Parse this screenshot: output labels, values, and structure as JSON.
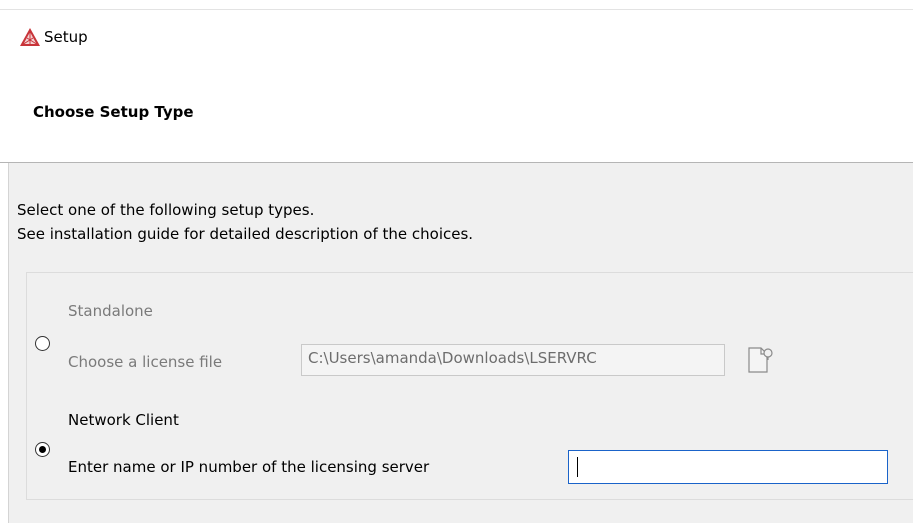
{
  "window": {
    "title": "Setup",
    "icon": "warning-triangle-icon"
  },
  "header": {
    "heading": "Choose Setup Type"
  },
  "description": {
    "line1": "Select one of the following setup types.",
    "line2": "See installation guide for detailed description of the choices."
  },
  "options": {
    "standalone": {
      "title": "Standalone",
      "selected": false,
      "enabled": false,
      "field_label": "Choose a license file",
      "field_value": "C:\\Users\\amanda\\Downloads\\LSERVRC",
      "browse_icon": "browse-file-icon"
    },
    "network": {
      "title": "Network Client",
      "selected": true,
      "enabled": true,
      "field_label": "Enter name or IP number of the licensing server",
      "field_value": ""
    }
  },
  "colors": {
    "panel_background": "#f0f0f0",
    "disabled_text": "#7a7a7a",
    "focus_border": "#1a63c9",
    "icon_red": "#c8343a"
  }
}
